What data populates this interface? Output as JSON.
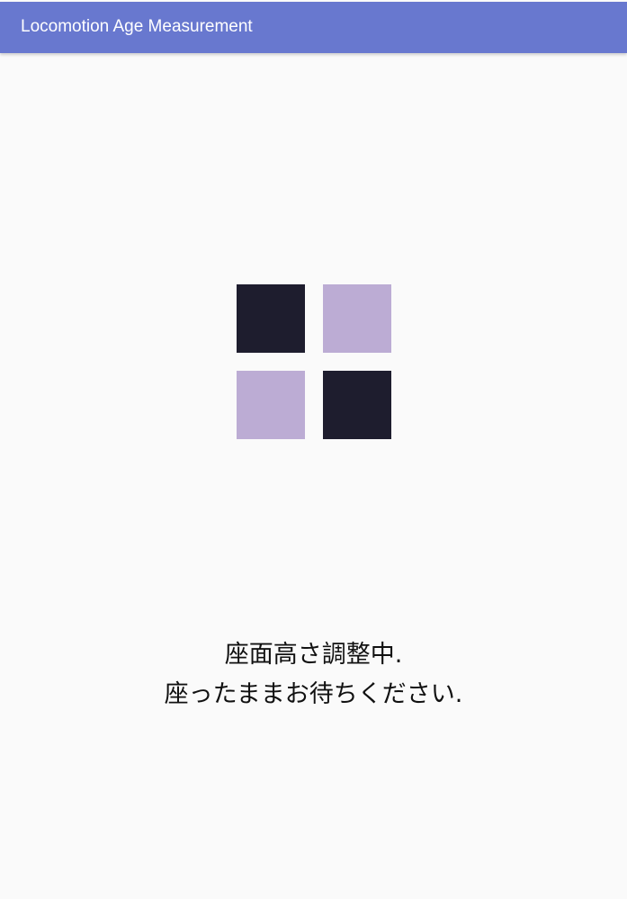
{
  "app_bar": {
    "title": "Locomotion Age Measurement",
    "color": "#6878cf"
  },
  "loader": {
    "icon": "four-square-loading-indicator",
    "colors": {
      "dark": "#1e1d2e",
      "light": "#bcacd4"
    },
    "tiles": [
      "dark",
      "light",
      "light",
      "dark"
    ]
  },
  "status": {
    "line1": "座面高さ調整中.",
    "line2": "座ったままお待ちください."
  }
}
